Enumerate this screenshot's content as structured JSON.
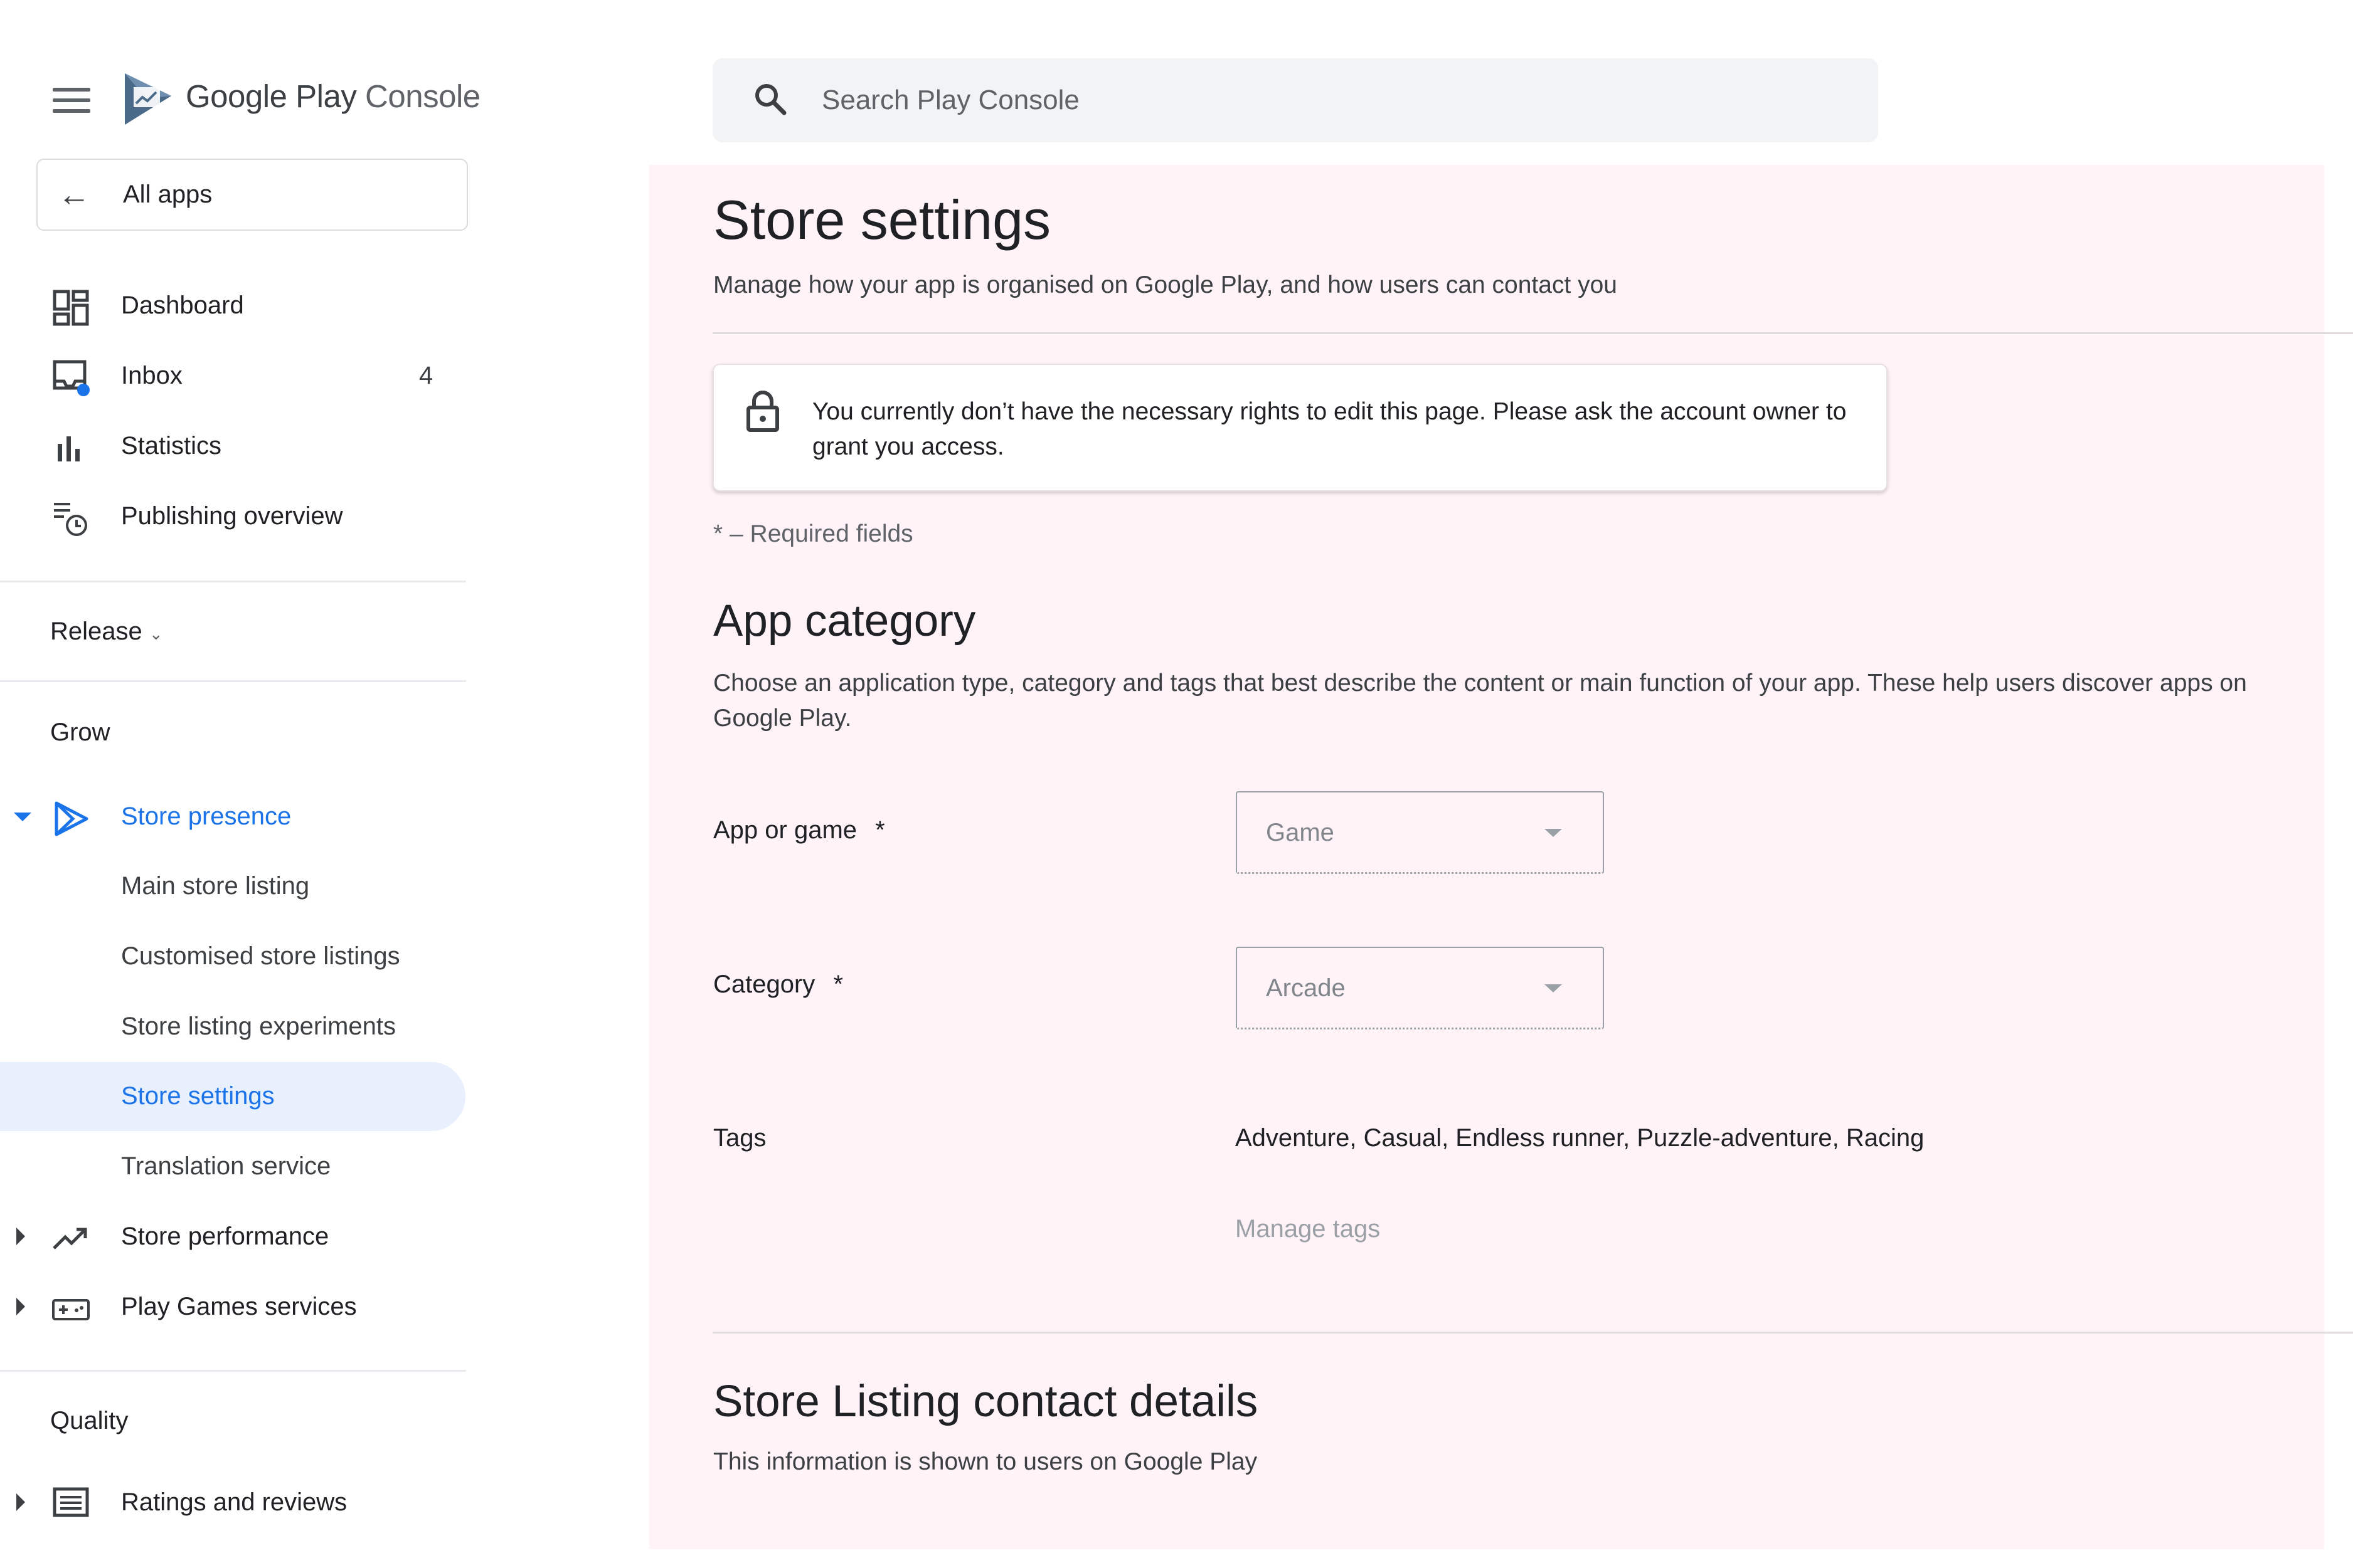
{
  "app": {
    "logo_google": "Google Play",
    "logo_console": "Console"
  },
  "search": {
    "placeholder": "Search Play Console"
  },
  "sidebar": {
    "all_apps": "All apps",
    "top_items": [
      {
        "label": "Dashboard",
        "icon": "dashboard-icon"
      },
      {
        "label": "Inbox",
        "icon": "inbox-icon",
        "count": "4"
      },
      {
        "label": "Statistics",
        "icon": "bar-chart-icon"
      },
      {
        "label": "Publishing overview",
        "icon": "publishing-overview-icon"
      }
    ],
    "release": "Release",
    "grow": "Grow",
    "store_presence": {
      "label": "Store presence",
      "icon": "play-store-presence-icon",
      "children": [
        {
          "label": "Main store listing"
        },
        {
          "label": "Customised store listings"
        },
        {
          "label": "Store listing experiments"
        },
        {
          "label": "Store settings",
          "active": true
        },
        {
          "label": "Translation service"
        }
      ]
    },
    "store_performance": "Store performance",
    "play_games_services": "Play Games services",
    "quality": "Quality",
    "ratings_and_reviews": "Ratings and reviews",
    "active_color": "#1a73e8",
    "active_bg": "#e8f0fe"
  },
  "main": {
    "title": "Store settings",
    "subtitle": "Manage how your app is organised on Google Play, and how users can contact you",
    "notice": "You currently don’t have the necessary rights to edit this page. Please ask the account owner to grant you access.",
    "required_note": "* – Required fields",
    "app_category": {
      "heading": "App category",
      "description": "Choose an application type, category and tags that best describe the content or main function of your app. These help users discover apps on Google Play.",
      "app_or_game_label": "App or game",
      "app_or_game_value": "Game",
      "category_label": "Category",
      "category_value": "Arcade",
      "required_mark": "*",
      "tags_label": "Tags",
      "tags_value": "Adventure, Casual, Endless runner, Puzzle-adventure, Racing",
      "manage_tags": "Manage tags"
    },
    "contact": {
      "heading": "Store Listing contact details",
      "description": "This information is shown to users on Google Play"
    },
    "background": "#fff3f8"
  }
}
